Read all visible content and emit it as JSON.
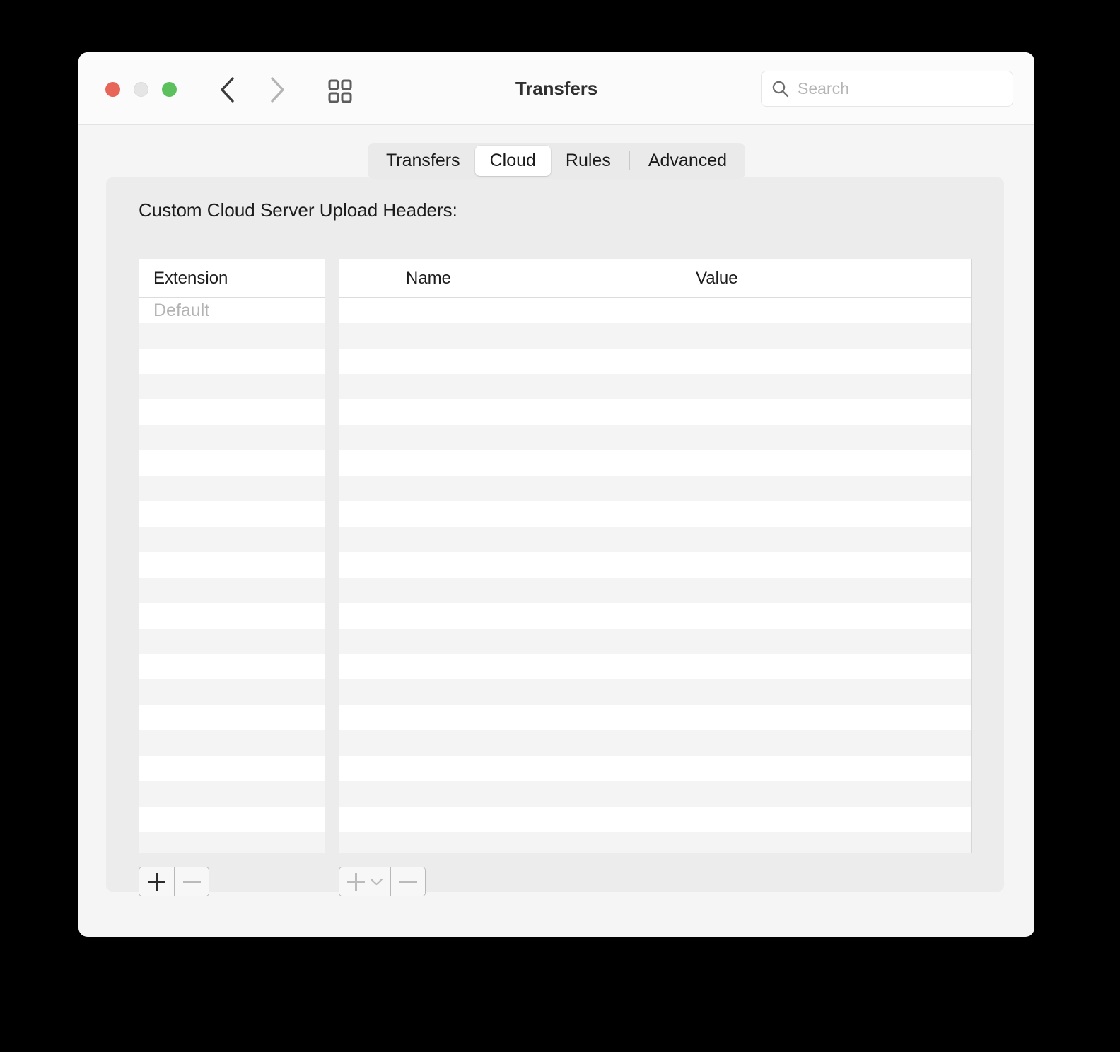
{
  "window": {
    "title": "Transfers",
    "traffic_lights": [
      {
        "name": "close",
        "color": "#E8655A"
      },
      {
        "name": "minimize",
        "color": "#E5E5E5"
      },
      {
        "name": "zoom",
        "color": "#5CC15C"
      }
    ],
    "nav": {
      "back_icon": "chevron-left-icon",
      "forward_icon": "chevron-right-icon",
      "grid_icon": "grid-view-icon"
    }
  },
  "search": {
    "icon": "search-icon",
    "value": "",
    "placeholder": "Search"
  },
  "tabs": [
    {
      "label": "Transfers",
      "selected": false
    },
    {
      "label": "Cloud",
      "selected": true
    },
    {
      "label": "Rules",
      "selected": false
    },
    {
      "label": "Advanced",
      "selected": false
    }
  ],
  "panel": {
    "label": "Custom Cloud Server Upload Headers:"
  },
  "extensions_table": {
    "columns": [
      "Extension"
    ],
    "rows": [
      {
        "extension": "Default",
        "placeholder": true
      }
    ],
    "total_visible_rows": 22
  },
  "headers_table": {
    "columns": [
      "",
      "Name",
      "Value"
    ],
    "rows": [],
    "total_visible_rows": 22
  },
  "footer": {
    "extensions_buttons": [
      {
        "name": "add-extension-button",
        "glyph": "plus",
        "enabled": true
      },
      {
        "name": "remove-extension-button",
        "glyph": "minus",
        "enabled": false
      }
    ],
    "headers_buttons": [
      {
        "name": "add-header-button",
        "glyph": "plus-menu",
        "enabled": false
      },
      {
        "name": "remove-header-button",
        "glyph": "minus",
        "enabled": false
      }
    ]
  },
  "colors": {
    "window_bg": "#F5F5F5",
    "titlebar_bg": "#FBFBFB",
    "panel_bg": "#ECECEC",
    "row_alt": "#F4F4F4",
    "selected_tab_bg": "#FFFFFF"
  }
}
